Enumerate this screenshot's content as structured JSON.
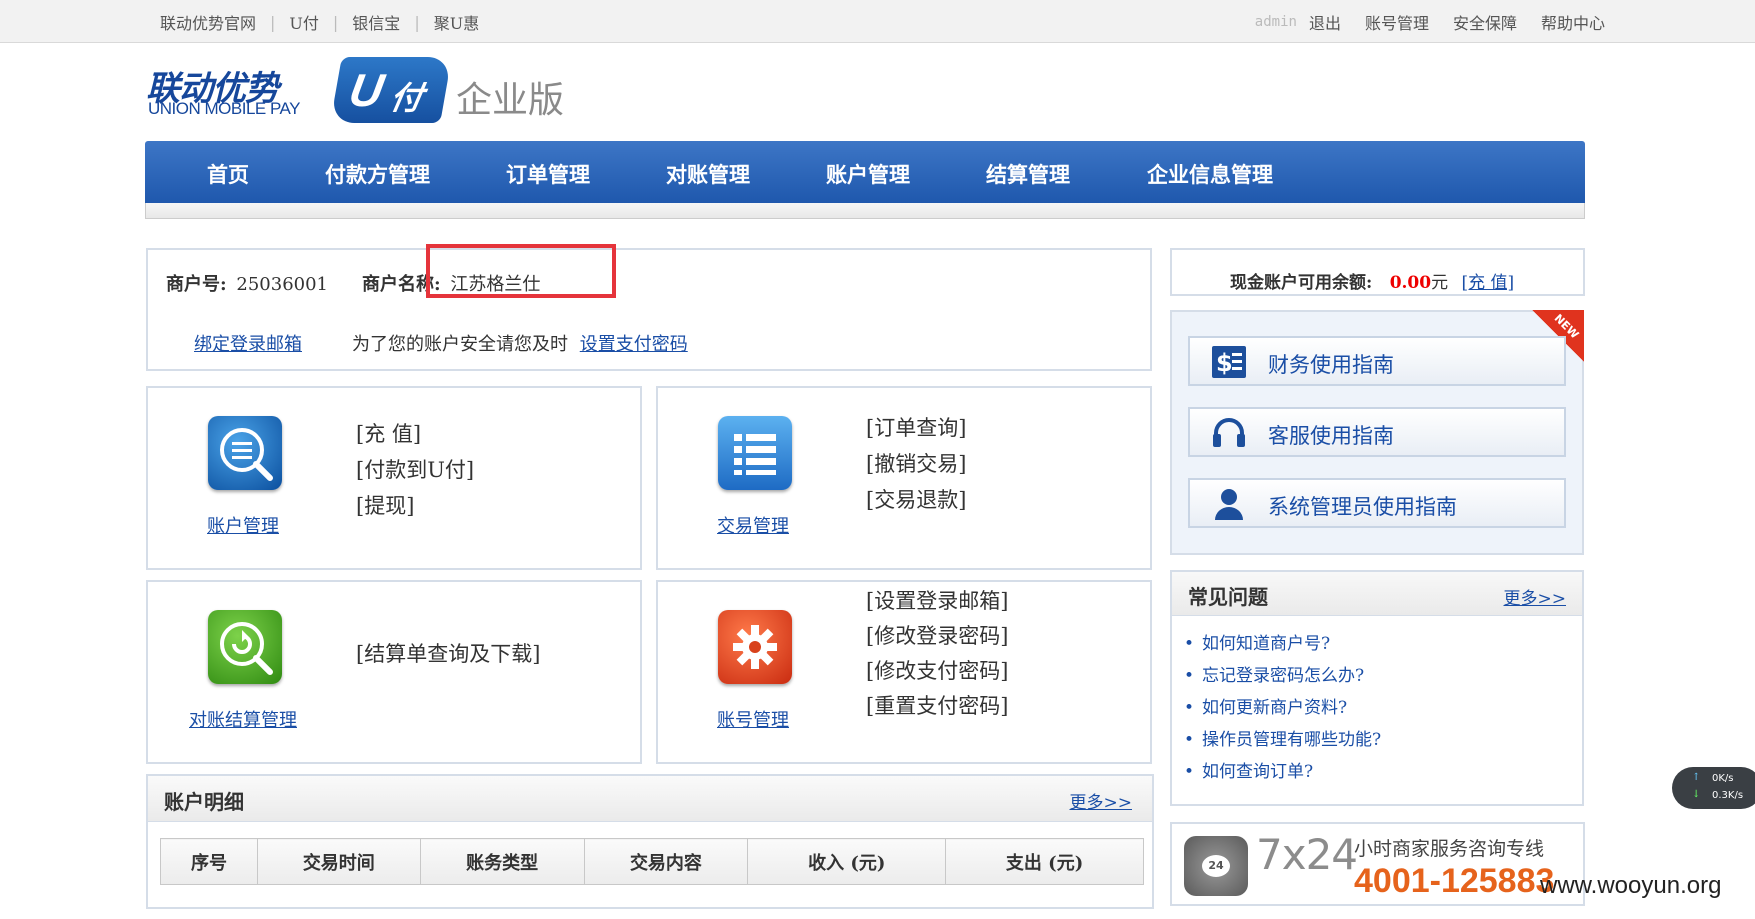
{
  "topbar": {
    "left_links": [
      "联动优势官网",
      "U付",
      "银信宝",
      "聚U惠"
    ],
    "user": "admin",
    "logout": "退出",
    "account_mgmt": "账号管理",
    "security": "安全保障",
    "help": "帮助中心"
  },
  "logo": {
    "cn": "联动优势",
    "en": "UNION MOBILE PAY",
    "u": "U",
    "fu": "付",
    "edition": "企业版"
  },
  "nav": [
    "首页",
    "付款方管理",
    "订单管理",
    "对账管理",
    "账户管理",
    "结算管理",
    "企业信息管理"
  ],
  "merchant": {
    "id_label": "商户号:",
    "id_value": "25036001",
    "name_label": "商户名称:",
    "name_value": "江苏格兰仕",
    "bind_email": "绑定登录邮箱",
    "security_tip": "为了您的账户安全请您及时",
    "set_pay_pwd": "设置支付密码"
  },
  "cards": {
    "account": {
      "caption": "账户管理",
      "links": [
        "[充 值]",
        "[付款到U付]",
        "[提现]"
      ]
    },
    "trade": {
      "caption": "交易管理",
      "links": [
        "[订单查询]",
        "[撤销交易]",
        "[交易退款]"
      ]
    },
    "reconcile": {
      "caption": "对账结算管理",
      "links": [
        "[结算单查询及下载]"
      ]
    },
    "profile": {
      "caption": "账号管理",
      "links": [
        "[设置登录邮箱]",
        "[修改登录密码]",
        "[修改支付密码]",
        "[重置支付密码]"
      ]
    }
  },
  "detail": {
    "title": "账户明细",
    "more": "更多>>",
    "columns": [
      "序号",
      "交易时间",
      "账务类型",
      "交易内容",
      "收入 (元)",
      "支出 (元)"
    ]
  },
  "balance": {
    "label": "现金账户可用余额:",
    "amount": "0.00",
    "unit": "元",
    "recharge": "[充 值]"
  },
  "guides": {
    "new_badge": "NEW",
    "items": [
      "财务使用指南",
      "客服使用指南",
      "系统管理员使用指南"
    ]
  },
  "faq": {
    "title": "常见问题",
    "more": "更多>>",
    "items": [
      "如何知道商户号?",
      "忘记登录密码怎么办?",
      "如何更新商户资料?",
      "操作员管理有哪些功能?",
      "如何查询订单?"
    ]
  },
  "hotline": {
    "badge": "24",
    "service": "7x24",
    "desc": "小时商家服务咨询专线",
    "number": "4001-125883"
  },
  "watermark": "www.wooyun.org",
  "speed": {
    "up": "0K/s",
    "down": "0.3K/s"
  },
  "colors": {
    "nav": "#1f58ad",
    "link": "#1a4ea6",
    "highlight": "#e5343b",
    "hotline": "#e6631c"
  }
}
